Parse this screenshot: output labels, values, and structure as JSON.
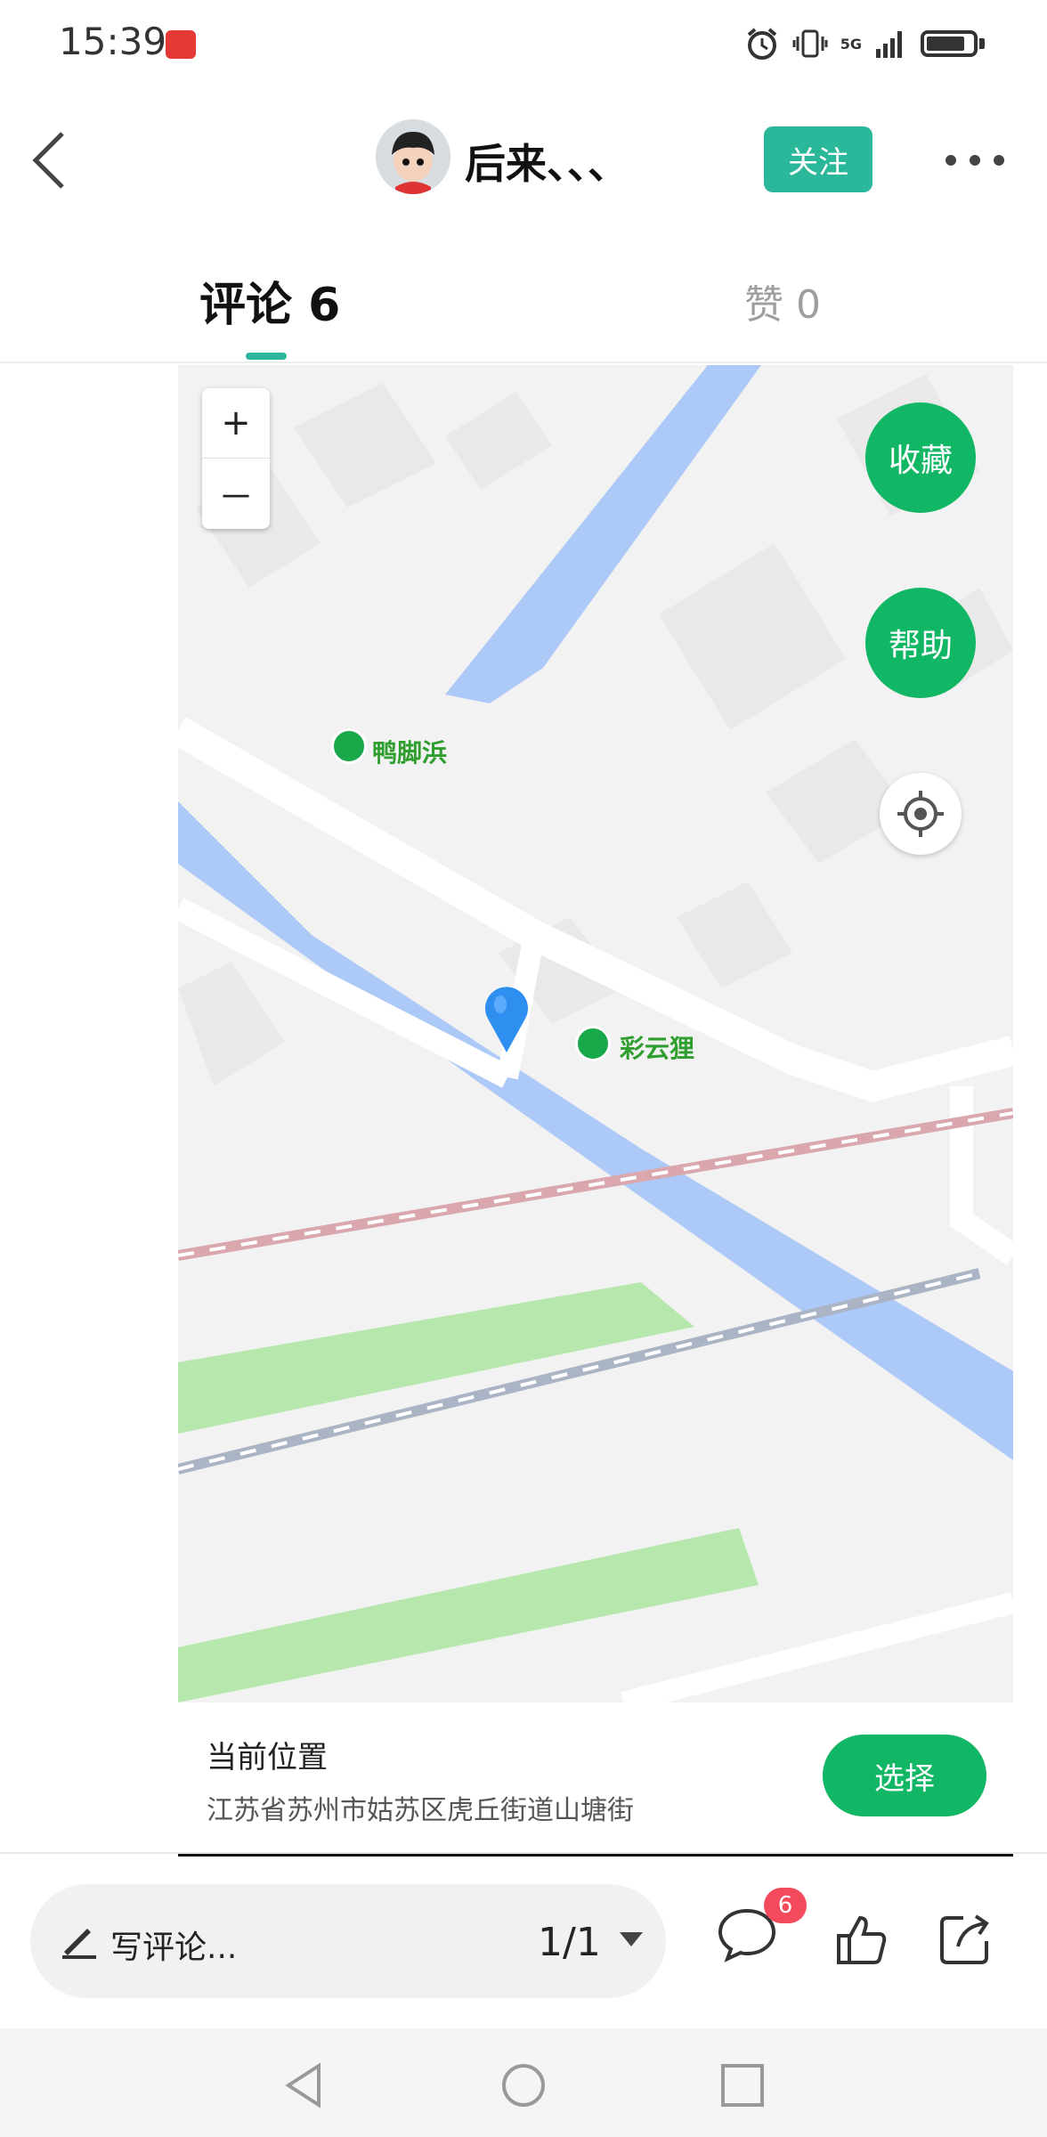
{
  "status_bar": {
    "time": "15:39",
    "network": "5G"
  },
  "header": {
    "username": "后来、、、",
    "follow_label": "关注"
  },
  "tabs": {
    "comments_label": "评论 6",
    "likes_label": "赞 0"
  },
  "map": {
    "zoom_in": "+",
    "zoom_out": "－",
    "collect_label": "收藏",
    "help_label": "帮助",
    "poi_1": "鸭脚浜",
    "poi_2": "彩云狸"
  },
  "location": {
    "title": "当前位置",
    "address": "江苏省苏州市姑苏区虎丘街道山塘街",
    "select_label": "选择"
  },
  "bottom_bar": {
    "comment_placeholder": "写评论...",
    "page_indicator": "1/1",
    "comment_count_badge": "6"
  },
  "colors": {
    "accent": "#2bb89a",
    "map_green": "#11b764",
    "water": "#adc9f7",
    "park": "#b6e8ad",
    "badge": "#f44b5c"
  }
}
